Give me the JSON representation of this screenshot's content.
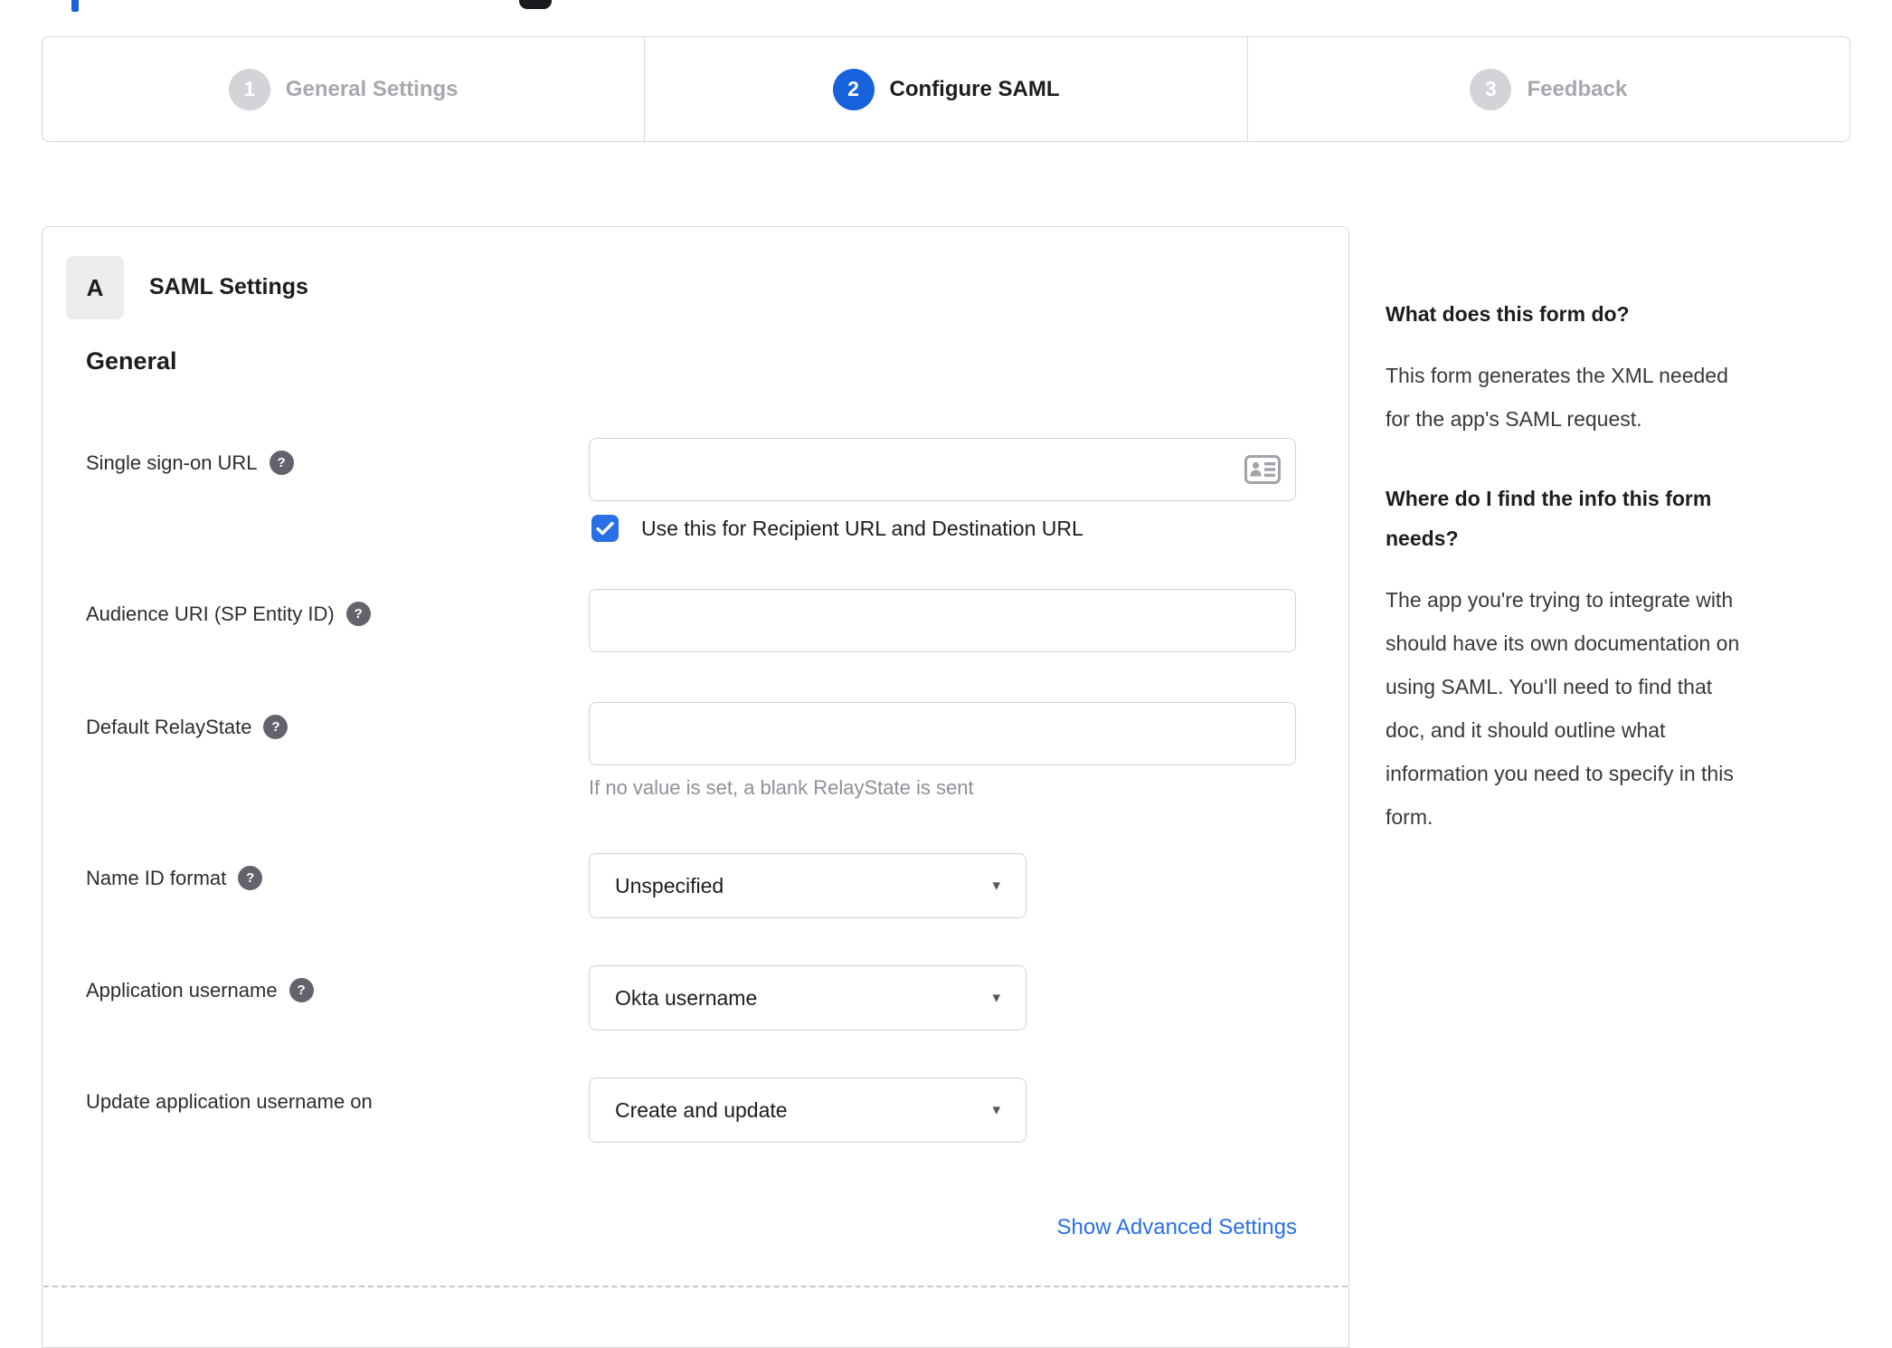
{
  "colors": {
    "accent_blue": "#1662dd",
    "checkbox_blue": "#2970e6",
    "link_blue": "#2970e6",
    "border_gray": "#d7d7dc",
    "inactive_gray": "#a7a7ae"
  },
  "icons": {
    "help_glyph": "?",
    "caret_glyph": "▾"
  },
  "stepper": {
    "steps": [
      {
        "number": "1",
        "label": "General Settings",
        "state": "inactive"
      },
      {
        "number": "2",
        "label": "Configure SAML",
        "state": "active"
      },
      {
        "number": "3",
        "label": "Feedback",
        "state": "inactive"
      }
    ]
  },
  "panel": {
    "section_badge": "A",
    "section_title": "SAML Settings",
    "group_heading": "General",
    "fields": [
      {
        "label": "Single sign-on URL",
        "type": "input",
        "value": "",
        "checkbox_checked": true,
        "checkbox_label": "Use this for Recipient URL and Destination URL"
      },
      {
        "label": "Audience URI (SP Entity ID)",
        "type": "input",
        "value": ""
      },
      {
        "label": "Default RelayState",
        "type": "input",
        "value": "",
        "hint": "If no value is set, a blank RelayState is sent"
      },
      {
        "label": "Name ID format",
        "type": "select",
        "value": "Unspecified"
      },
      {
        "label": "Application username",
        "type": "select",
        "value": "Okta username"
      },
      {
        "label": "Update application username on",
        "type": "select",
        "value": "Create and update"
      }
    ],
    "advanced_link": "Show Advanced Settings"
  },
  "sidebar": {
    "heading1": "What does this form do?",
    "paragraph1_lines": [
      "This form generates the XML needed",
      "for the app's SAML request."
    ],
    "heading2_lines": [
      "Where do I find the info this form",
      "needs?"
    ],
    "paragraph2_lines": [
      "The app you're trying to integrate with",
      "should have its own documentation on",
      "using SAML. You'll need to find that",
      "doc, and it should outline what",
      "information you need to specify in this",
      "form."
    ]
  }
}
